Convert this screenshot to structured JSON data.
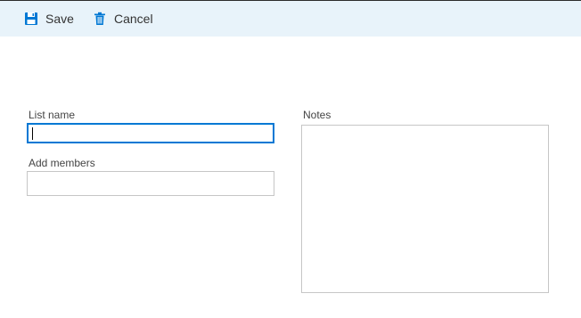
{
  "toolbar": {
    "save_label": "Save",
    "save_icon": "floppy-disk-icon",
    "cancel_label": "Cancel",
    "cancel_icon": "trash-icon",
    "accent_color": "#0078d4",
    "background_color": "#e8f3fa"
  },
  "form": {
    "list_name": {
      "label": "List name",
      "value": "",
      "placeholder": ""
    },
    "add_members": {
      "label": "Add members",
      "value": "",
      "placeholder": ""
    },
    "notes": {
      "label": "Notes",
      "value": "",
      "placeholder": ""
    }
  }
}
